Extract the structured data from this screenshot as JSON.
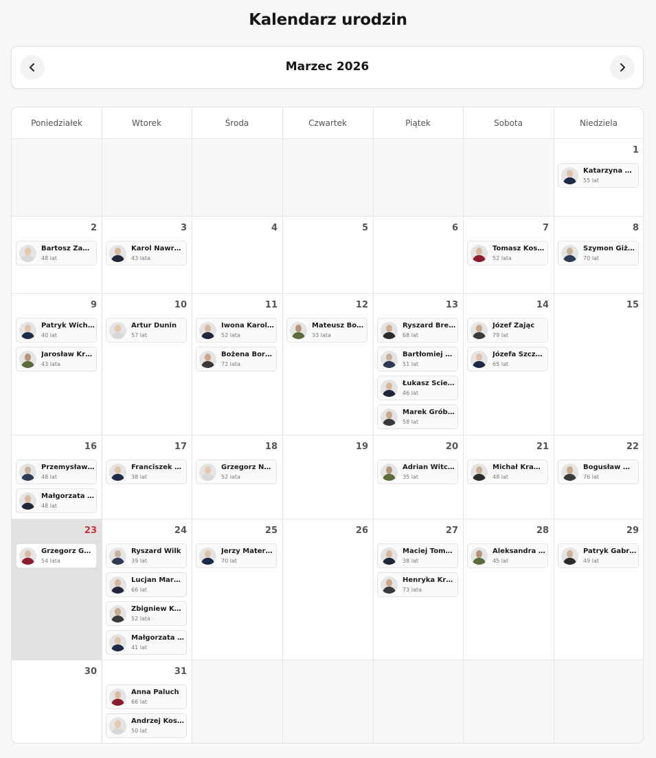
{
  "title": "Kalendarz urodzin",
  "month_label": "Marzec 2026",
  "weekdays": [
    "Poniedziałek",
    "Wtorek",
    "Środa",
    "Czwartek",
    "Piątek",
    "Sobota",
    "Niedziela"
  ],
  "today_day": 23,
  "colors": {
    "today_bg": "#e3e1e1",
    "today_num": "#c9303e"
  },
  "days": [
    {
      "day": 1,
      "people": [
        {
          "name": "Katarzyna Kr…",
          "age": "55 lat"
        }
      ]
    },
    {
      "day": 2,
      "people": [
        {
          "name": "Bartosz Zawi…",
          "age": "48 lat"
        }
      ]
    },
    {
      "day": 3,
      "people": [
        {
          "name": "Karol Nawrocki",
          "age": "43 lata"
        }
      ]
    },
    {
      "day": 4,
      "people": []
    },
    {
      "day": 5,
      "people": []
    },
    {
      "day": 6,
      "people": []
    },
    {
      "day": 7,
      "people": [
        {
          "name": "Tomasz Kostuś",
          "age": "52 lata"
        }
      ]
    },
    {
      "day": 8,
      "people": [
        {
          "name": "Szymon Giży…",
          "age": "70 lat"
        }
      ]
    },
    {
      "day": 9,
      "people": [
        {
          "name": "Patryk Wicher",
          "age": "40 lat"
        },
        {
          "name": "Jarosław Kraj…",
          "age": "43 lata"
        }
      ]
    },
    {
      "day": 10,
      "people": [
        {
          "name": "Artur Dunin",
          "age": "57 lat"
        }
      ]
    },
    {
      "day": 11,
      "people": [
        {
          "name": "Iwona Karole…",
          "age": "52 lata"
        },
        {
          "name": "Bożena Borys…",
          "age": "72 lata"
        }
      ]
    },
    {
      "day": 12,
      "people": [
        {
          "name": "Mateusz Boc…",
          "age": "33 lata"
        }
      ]
    },
    {
      "day": 13,
      "people": [
        {
          "name": "Ryszard Brejza",
          "age": "68 lat"
        },
        {
          "name": "Bartłomiej Wr…",
          "age": "51 lat"
        },
        {
          "name": "Łukasz Ściebi…",
          "age": "46 lat"
        },
        {
          "name": "Marek Gróba…",
          "age": "58 lat"
        }
      ]
    },
    {
      "day": 14,
      "people": [
        {
          "name": "Józef Zając",
          "age": "79 lat"
        },
        {
          "name": "Józefa Szczur…",
          "age": "65 lat"
        }
      ]
    },
    {
      "day": 15,
      "people": []
    },
    {
      "day": 16,
      "people": [
        {
          "name": "Przemysław …",
          "age": "48 lat"
        },
        {
          "name": "Małgorzata W…",
          "age": "48 lat"
        }
      ]
    },
    {
      "day": 17,
      "people": [
        {
          "name": "Franciszek St…",
          "age": "38 lat"
        }
      ]
    },
    {
      "day": 18,
      "people": [
        {
          "name": "Grzegorz Nap…",
          "age": "52 lata"
        }
      ]
    },
    {
      "day": 19,
      "people": []
    },
    {
      "day": 20,
      "people": [
        {
          "name": "Adrian Witcz…",
          "age": "35 lat"
        }
      ]
    },
    {
      "day": 21,
      "people": [
        {
          "name": "Michał Krawc…",
          "age": "48 lat"
        }
      ]
    },
    {
      "day": 22,
      "people": [
        {
          "name": "Bogusław Wo…",
          "age": "76 lat"
        }
      ]
    },
    {
      "day": 23,
      "people": [
        {
          "name": "Grzegorz Gaża",
          "age": "54 lata"
        }
      ]
    },
    {
      "day": 24,
      "people": [
        {
          "name": "Ryszard Wilk",
          "age": "39 lat"
        },
        {
          "name": "Lucjan Marek…",
          "age": "66 lat"
        },
        {
          "name": "Zbigniew Kon…",
          "age": "52 lata"
        },
        {
          "name": "Małgorzata G…",
          "age": "41 lat"
        }
      ]
    },
    {
      "day": 25,
      "people": [
        {
          "name": "Jerzy Materna",
          "age": "70 lat"
        }
      ]
    },
    {
      "day": 26,
      "people": []
    },
    {
      "day": 27,
      "people": [
        {
          "name": "Maciej Tomcz…",
          "age": "38 lat"
        },
        {
          "name": "Henryka Krzy…",
          "age": "73 lata"
        }
      ]
    },
    {
      "day": 28,
      "people": [
        {
          "name": "Aleksandra L…",
          "age": "45 lat"
        }
      ]
    },
    {
      "day": 29,
      "people": [
        {
          "name": "Patryk Gabriel",
          "age": "49 lat"
        }
      ]
    },
    {
      "day": 30,
      "people": []
    },
    {
      "day": 31,
      "people": [
        {
          "name": "Anna Paluch",
          "age": "66 lat"
        },
        {
          "name": "Andrzej Koszt…",
          "age": "50 lat"
        }
      ]
    }
  ]
}
